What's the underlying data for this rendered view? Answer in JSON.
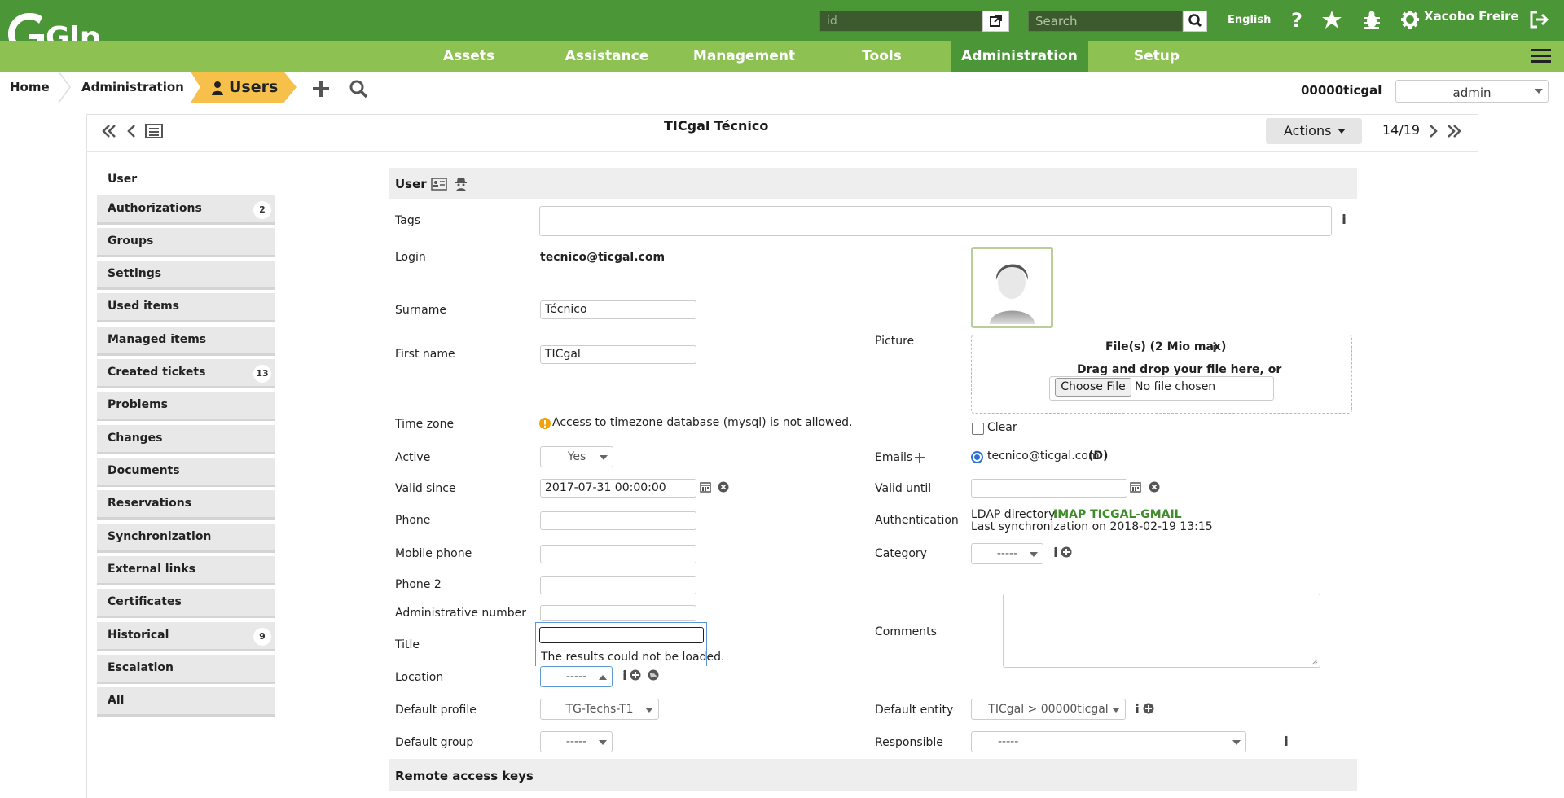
{
  "topbar": {
    "logo_text": "Glpi",
    "id_placeholder": "id",
    "search_placeholder": "Search",
    "language": "English",
    "user_name": "Xacobo Freire"
  },
  "menu": {
    "items": [
      "Assets",
      "Assistance",
      "Management",
      "Tools",
      "Administration",
      "Setup"
    ],
    "active": "Administration"
  },
  "breadcrumb": {
    "home": "Home",
    "section": "Administration",
    "current": "Users"
  },
  "entity": {
    "name": "00000ticgal",
    "profile": "admin"
  },
  "record": {
    "title": "TICgal Técnico",
    "actions_label": "Actions",
    "counter": "14/19"
  },
  "sidebar": {
    "items": [
      {
        "label": "User",
        "badge": ""
      },
      {
        "label": "Authorizations",
        "badge": "2"
      },
      {
        "label": "Groups",
        "badge": ""
      },
      {
        "label": "Settings",
        "badge": ""
      },
      {
        "label": "Used items",
        "badge": ""
      },
      {
        "label": "Managed items",
        "badge": ""
      },
      {
        "label": "Created tickets",
        "badge": "13"
      },
      {
        "label": "Problems",
        "badge": ""
      },
      {
        "label": "Changes",
        "badge": ""
      },
      {
        "label": "Documents",
        "badge": ""
      },
      {
        "label": "Reservations",
        "badge": ""
      },
      {
        "label": "Synchronization",
        "badge": ""
      },
      {
        "label": "External links",
        "badge": ""
      },
      {
        "label": "Certificates",
        "badge": ""
      },
      {
        "label": "Historical",
        "badge": "9"
      },
      {
        "label": "Escalation",
        "badge": ""
      },
      {
        "label": "All",
        "badge": ""
      }
    ]
  },
  "form": {
    "section_user": "User",
    "tags_label": "Tags",
    "login_label": "Login",
    "login_value": "tecnico@ticgal.com",
    "surname_label": "Surname",
    "surname_value": "Técnico",
    "firstname_label": "First name",
    "firstname_value": "TICgal",
    "picture_label": "Picture",
    "files_label": "File(s) (2 Mio max)",
    "drag_text": "Drag and drop your file here, or",
    "choose_file": "Choose File",
    "no_file": "No file chosen",
    "clear_label": "Clear",
    "timezone_label": "Time zone",
    "timezone_warning": "Access to timezone database (mysql) is not allowed.",
    "active_label": "Active",
    "active_value": "Yes",
    "emails_label": "Emails",
    "email_value": "tecnico@ticgal.com",
    "email_default": "(D)",
    "valid_since_label": "Valid since",
    "valid_since_value": "2017-07-31 00:00:00",
    "valid_until_label": "Valid until",
    "phone_label": "Phone",
    "auth_label": "Authentication",
    "auth_directory_prefix": "LDAP directory:",
    "auth_directory": "IMAP TICGAL-GMAIL",
    "auth_sync": "Last synchronization on 2018-02-19 13:15",
    "mobile_label": "Mobile phone",
    "category_label": "Category",
    "category_value": "-----",
    "phone2_label": "Phone 2",
    "admin_number_label": "Administrative number",
    "comments_label": "Comments",
    "title_label": "Title",
    "dropdown_message": "The results could not be loaded.",
    "location_label": "Location",
    "location_value": "-----",
    "default_profile_label": "Default profile",
    "default_profile_value": "TG-Techs-T1",
    "default_entity_label": "Default entity",
    "default_entity_value": "TICgal > 00000ticgal",
    "default_group_label": "Default group",
    "default_group_value": "-----",
    "responsible_label": "Responsible",
    "responsible_value": "-----",
    "section_remote": "Remote access keys"
  },
  "colors": {
    "topbar": "#4b9636",
    "menubar": "#8dc152",
    "breadcrumb_active": "#f7c04a"
  }
}
